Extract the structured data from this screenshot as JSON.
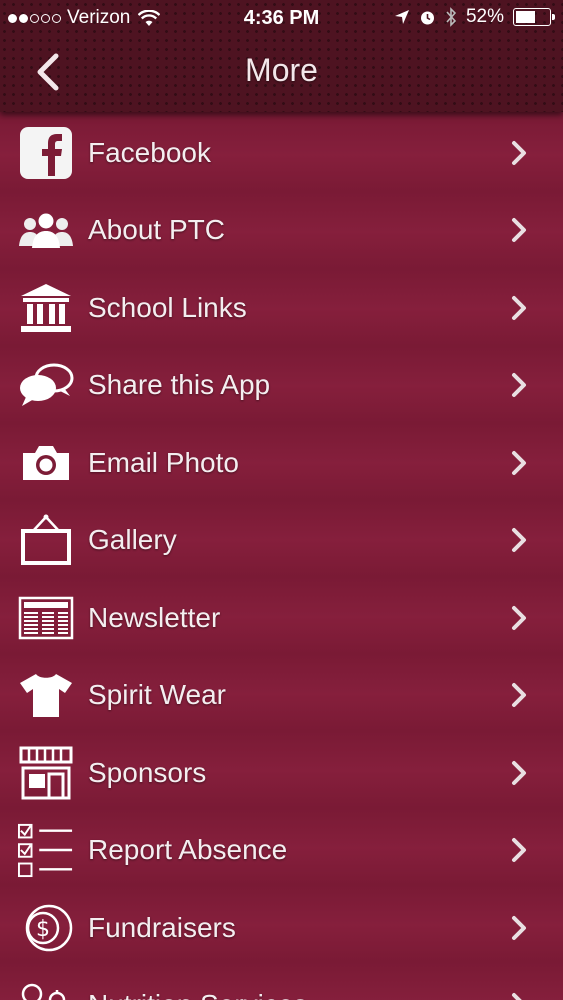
{
  "status_bar": {
    "carrier": "Verizon",
    "signal_bars": 2,
    "time": "4:36 PM",
    "battery": "52%",
    "battery_level": 0.52
  },
  "nav": {
    "title": "More",
    "back_icon": "chevron-left-icon"
  },
  "menu": [
    {
      "label": "Facebook",
      "icon": "facebook-icon"
    },
    {
      "label": "About PTC",
      "icon": "people-icon"
    },
    {
      "label": "School Links",
      "icon": "school-building-icon"
    },
    {
      "label": "Share this App",
      "icon": "speech-bubbles-icon"
    },
    {
      "label": "Email Photo",
      "icon": "camera-icon"
    },
    {
      "label": "Gallery",
      "icon": "picture-frame-icon"
    },
    {
      "label": "Newsletter",
      "icon": "newspaper-icon"
    },
    {
      "label": "Spirit Wear",
      "icon": "tshirt-icon"
    },
    {
      "label": "Sponsors",
      "icon": "storefront-icon"
    },
    {
      "label": "Report Absence",
      "icon": "checklist-icon"
    },
    {
      "label": "Fundraisers",
      "icon": "dollar-coin-icon"
    },
    {
      "label": "Nutrition Services",
      "icon": "nutrition-icon"
    }
  ],
  "colors": {
    "header": "#4e1321",
    "background": "#7c1c36",
    "text": "#f4eef0"
  }
}
